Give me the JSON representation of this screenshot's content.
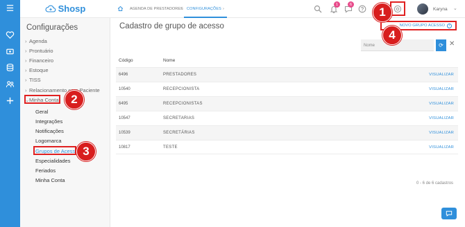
{
  "logo": {
    "text": "Shosp"
  },
  "sidebar": {
    "title": "Configurações",
    "sections": [
      {
        "label": "Agenda"
      },
      {
        "label": "Prontuário"
      },
      {
        "label": "Financeiro"
      },
      {
        "label": "Estoque"
      },
      {
        "label": "TISS"
      },
      {
        "label": "Relacionamento com Paciente"
      },
      {
        "label": "Minha Conta"
      }
    ],
    "submenu": [
      {
        "label": "Geral"
      },
      {
        "label": "Integrações"
      },
      {
        "label": "Notificações"
      },
      {
        "label": "Logomarca"
      },
      {
        "label": "Grupos de Acesso"
      },
      {
        "label": "Especialidades"
      },
      {
        "label": "Feriados"
      },
      {
        "label": "Minha Conta"
      }
    ]
  },
  "breadcrumbs": [
    {
      "label": "AGENDA DE PRESTADORES"
    },
    {
      "label": "CONFIGURAÇÕES"
    }
  ],
  "header": {
    "notification_count": "1",
    "messages_count": "6",
    "user_name": "Karyna"
  },
  "main": {
    "title": "Cadastro de grupo de acesso",
    "new_button": "NOVO GRUPO ACESSO",
    "search": {
      "placeholder": "Nome"
    },
    "table": {
      "columns": [
        "Código",
        "Nome"
      ],
      "rows": [
        {
          "code": "6496",
          "name": "PRESTADORES",
          "action": "VISUALIZAR"
        },
        {
          "code": "10540",
          "name": "RECEPCIONISTA",
          "action": "VISUALIZAR"
        },
        {
          "code": "6495",
          "name": "RECEPCIONISTAS",
          "action": "VISUALIZAR"
        },
        {
          "code": "10547",
          "name": "SECRETARIAS",
          "action": "VISUALIZAR"
        },
        {
          "code": "10539",
          "name": "SECRETÁRIAS",
          "action": "VISUALIZAR"
        },
        {
          "code": "10817",
          "name": "TESTE",
          "action": "VISUALIZAR"
        }
      ]
    },
    "count_text": "0 - 6 de 6 cadastros"
  },
  "annotations": [
    "1",
    "2",
    "3",
    "4"
  ],
  "colors": {
    "accent": "#2f8fdb",
    "callout": "#d81e1e",
    "badge": "#e84a8a"
  },
  "icons": [
    "menu-icon",
    "heart-icon",
    "card-icon",
    "database-icon",
    "people-icon",
    "plus-icon",
    "search-icon",
    "bell-icon",
    "chat-icon",
    "help-icon",
    "settings-icon",
    "home-icon",
    "refresh-icon",
    "close-icon"
  ]
}
